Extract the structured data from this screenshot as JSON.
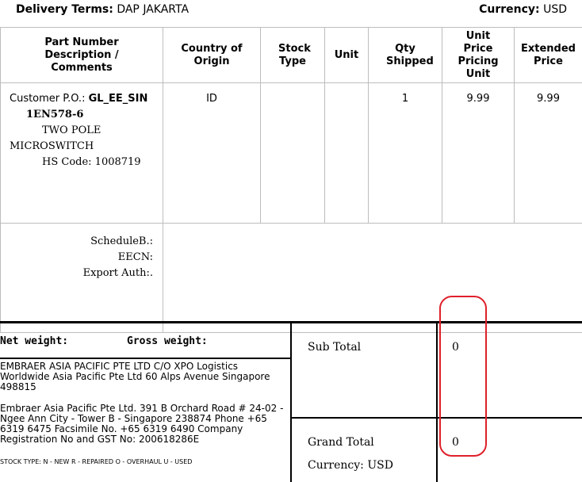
{
  "header": {
    "delivery_terms_label": "Delivery Terms:",
    "delivery_terms_value": "DAP JAKARTA",
    "currency_label": "Currency:",
    "currency_value": "USD"
  },
  "table": {
    "headers": [
      "Part Number Description / Comments",
      "Country of Origin",
      "Stock Type",
      "Unit",
      "Qty Shipped",
      "Unit Price Pricing Unit",
      "Extended Price"
    ],
    "line": {
      "customer_po_label": "Customer P.O.:",
      "customer_po_value": "GL_EE_SIN",
      "part_number": "1EN578-6",
      "description_line1": "TWO POLE",
      "description_line2": "MICROSWITCH",
      "hs_code": "HS Code: 1008719",
      "country_of_origin": "ID",
      "stock_type": "",
      "unit": "",
      "qty_shipped": "1",
      "unit_price": "9.99",
      "extended_price": "9.99"
    },
    "export": {
      "schedule_b": "ScheduleB.:",
      "eecn": "EECN:",
      "export_auth": "Export Auth:."
    }
  },
  "footer": {
    "net_weight_label": "Net weight:",
    "gross_weight_label": "Gross weight:",
    "address1": "EMBRAER ASIA PACIFIC PTE LTD C/O XPO Logistics Worldwide Asia Pacific Pte Ltd 60 Alps Avenue Singapore 498815",
    "address2": "Embraer Asia Pacific Pte Ltd. 391 B Orchard Road # 24-02 - Ngee Ann City - Tower B - Singapore 238874 Phone +65 6319 6475 Facsimile No. +65 6319 6490 Company Registration No and GST No: 200618286E",
    "stock_type_legend": "STOCK TYPE: N - NEW R - REPAIRED O - OVERHAUL U - USED",
    "sub_total_label": "Sub Total",
    "sub_total_value": "0",
    "grand_total_label": "Grand Total",
    "grand_total_value": "0",
    "currency_text": "Currency: USD"
  },
  "annotation_color": "#e0202a"
}
